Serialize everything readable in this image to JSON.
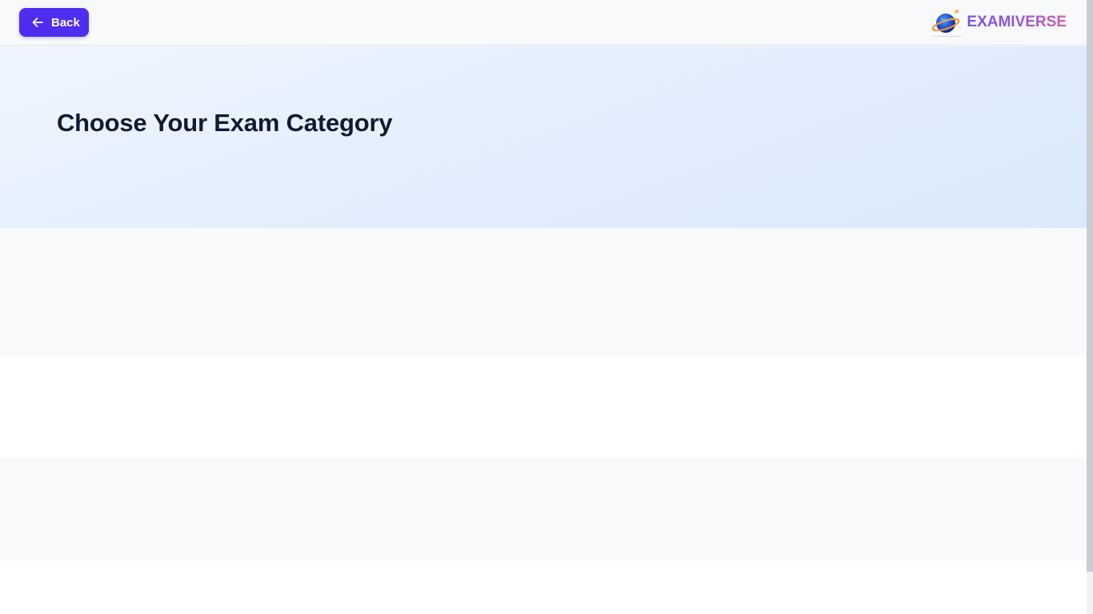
{
  "header": {
    "back_label": "Back",
    "brand_name": "EXAMIVERSE"
  },
  "hero": {
    "title": "Choose Your Exam Category"
  },
  "colors": {
    "primary_button": "#4f2df0",
    "hero_background": "#e3eefd",
    "title_text": "#0f1b33",
    "brand_gradient_start": "#7b4fe6",
    "brand_gradient_end": "#d45aa6"
  },
  "icons": {
    "back": "arrow-left-icon",
    "logo": "planet-rocket-logo-icon"
  }
}
